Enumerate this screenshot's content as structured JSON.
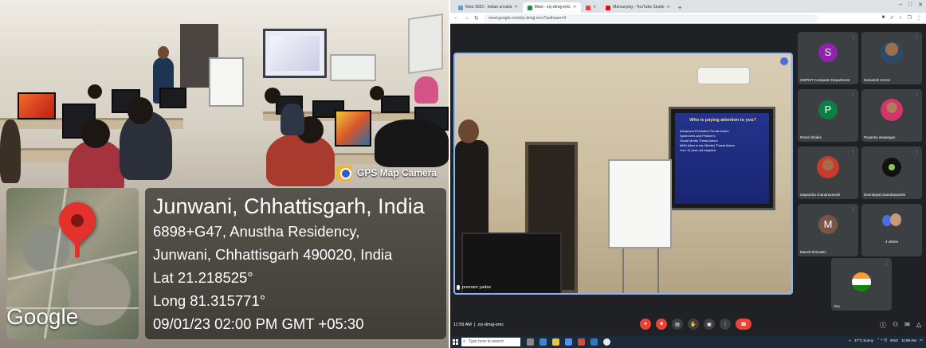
{
  "photo": {
    "badge": "GPS Map Camera",
    "map_brand": "Google",
    "location_title": "Junwani, Chhattisgarh, India",
    "address_line1": "6898+G47, Anustha Residency,",
    "address_line2": "Junwani, Chhattisgarh 490020, India",
    "latitude": "Lat 21.218525°",
    "longitude": "Long 81.315771°",
    "datetime": "09/01/23 02:00 PM GMT +05:30"
  },
  "browser": {
    "tabs": [
      {
        "label": "Nrse 2023 - Indian unvaila",
        "color": "#6a9ad6",
        "active": false
      },
      {
        "label": "Meet - ziy-dmqj-emc",
        "color": "#1e8e3e",
        "active": true
      },
      {
        "label": "",
        "color": "#ea4335",
        "active": false
      },
      {
        "label": "Mercurying - YouTube Studio",
        "color": "#ff0000",
        "active": false
      }
    ],
    "url": "meet.google.com/ziy-dmqj-emc?authuser=0"
  },
  "meet": {
    "speaker_name": "poonam yadav",
    "slide_title": "Who is paying attention to you?",
    "slide_items": [
      "Advanced Persistent Threat Actors",
      "Spammers and Phisher's",
      "Social Media Threat Actors",
      "MitM (Man in the Middle) Threat Actors",
      "Your 12 year old neighbor"
    ],
    "participants": [
      {
        "name": "SSIPMT Computer Department",
        "initial": "S",
        "color": "#8e24aa"
      },
      {
        "name": "Nameesh SAHU",
        "initial": "",
        "color": ""
      },
      {
        "name": "Preeti Shukla",
        "initial": "P",
        "color": "#0b8043"
      },
      {
        "name": "Priyanka dewangan",
        "initial": "",
        "color": ""
      },
      {
        "name": "satyandra chandravanshi",
        "initial": "",
        "color": ""
      },
      {
        "name": "Deendayal chandravanshi",
        "initial": "",
        "color": ""
      },
      {
        "name": "Mansil Shrivastv",
        "initial": "M",
        "color": "#795548"
      },
      {
        "name": "4 others",
        "initial": "",
        "color": ""
      }
    ],
    "self_label": "You",
    "clock": "11:59 AM",
    "meeting_code": "ziy-dmqj-emc"
  },
  "taskbar": {
    "search_placeholder": "Type here to search",
    "weather": "27°C Sunny",
    "lang": "ENG",
    "time": "11:59 AM"
  }
}
